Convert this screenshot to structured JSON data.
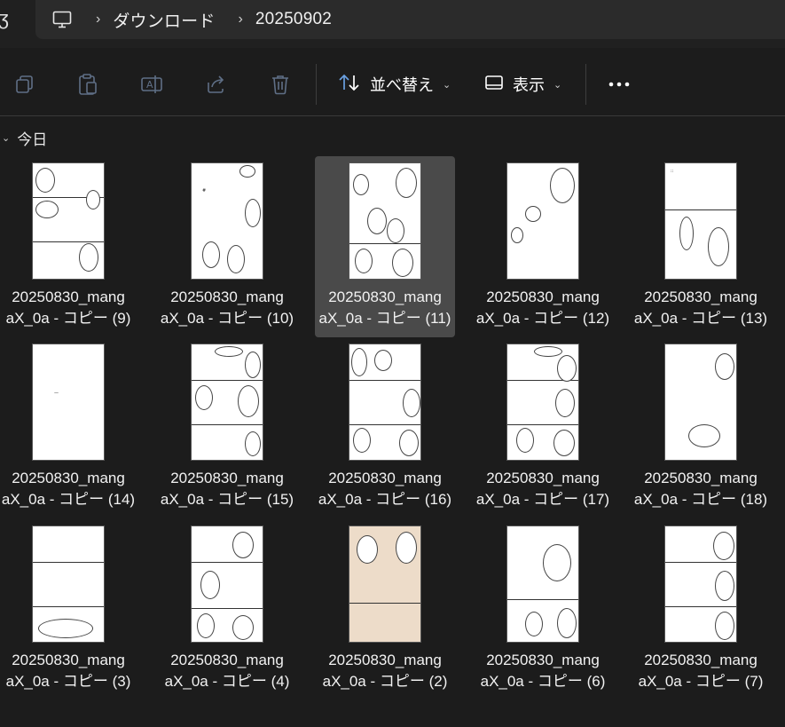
{
  "address": {
    "left_glyph": "ʒ",
    "pc_icon": "monitor-icon",
    "crumbs": [
      "ダウンロード",
      "20250902"
    ]
  },
  "toolbar": {
    "copy_icon": "copy-icon",
    "paste_icon": "paste-icon",
    "rename_icon": "rename-icon",
    "share_icon": "share-icon",
    "delete_icon": "trash-icon",
    "sort_label": "並べ替え",
    "view_label": "表示",
    "more_icon": "more-icon"
  },
  "group": {
    "label": "今日"
  },
  "files": [
    {
      "name_line1": "20250830_mang",
      "name_line2": "aX_0a - コピー (9)",
      "style": "a"
    },
    {
      "name_line1": "20250830_mang",
      "name_line2": "aX_0a - コピー (10)",
      "style": "b"
    },
    {
      "name_line1": "20250830_mang",
      "name_line2": "aX_0a - コピー (11)",
      "style": "c",
      "selected": true
    },
    {
      "name_line1": "20250830_mang",
      "name_line2": "aX_0a - コピー (12)",
      "style": "d"
    },
    {
      "name_line1": "20250830_mang",
      "name_line2": "aX_0a - コピー (13)",
      "style": "e"
    },
    {
      "name_line1": "20250830_mang",
      "name_line2": "aX_0a - コピー (14)",
      "style": "f"
    },
    {
      "name_line1": "20250830_mang",
      "name_line2": "aX_0a - コピー (15)",
      "style": "g"
    },
    {
      "name_line1": "20250830_mang",
      "name_line2": "aX_0a - コピー (16)",
      "style": "h"
    },
    {
      "name_line1": "20250830_mang",
      "name_line2": "aX_0a - コピー (17)",
      "style": "i"
    },
    {
      "name_line1": "20250830_mang",
      "name_line2": "aX_0a - コピー (18)",
      "style": "j"
    },
    {
      "name_line1": "20250830_mang",
      "name_line2": "aX_0a - コピー (3)",
      "style": "k"
    },
    {
      "name_line1": "20250830_mang",
      "name_line2": "aX_0a - コピー (4)",
      "style": "l"
    },
    {
      "name_line1": "20250830_mang",
      "name_line2": "aX_0a - コピー (2)",
      "style": "m"
    },
    {
      "name_line1": "20250830_mang",
      "name_line2": "aX_0a - コピー (6)",
      "style": "n"
    },
    {
      "name_line1": "20250830_mang",
      "name_line2": "aX_0a - コピー (7)",
      "style": "o"
    }
  ],
  "colors": {
    "background": "#1c1c1c",
    "address_bar": "#2b2b2b",
    "selected_tile": "#4a4a4a",
    "text": "#f2f2f2"
  }
}
